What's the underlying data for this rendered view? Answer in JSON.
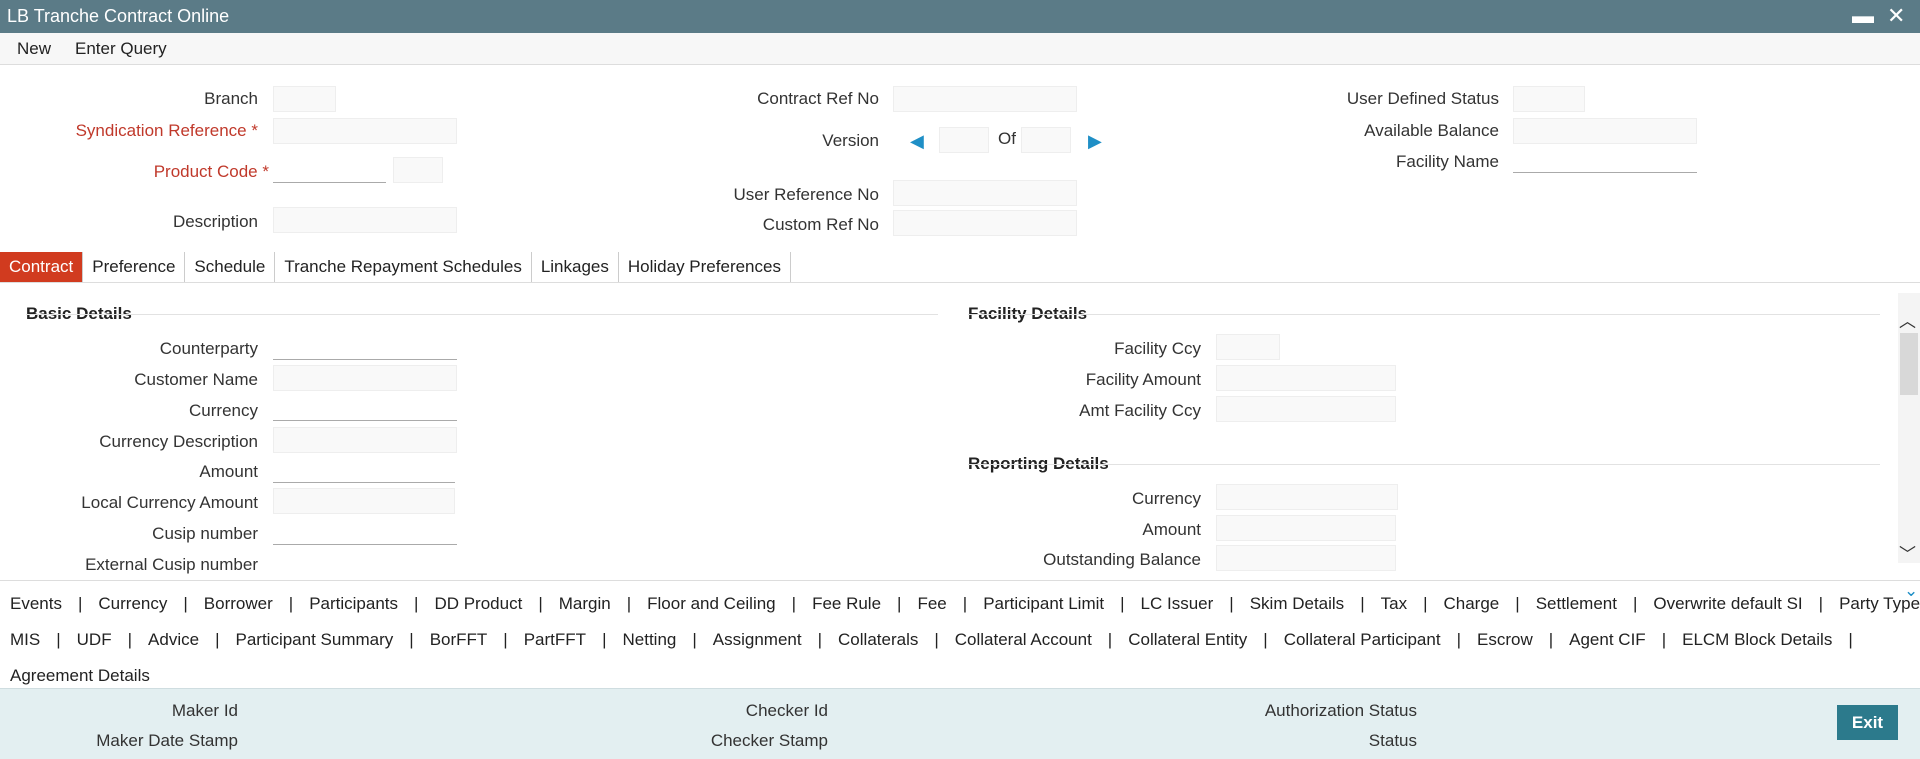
{
  "window": {
    "title": "LB Tranche Contract Online",
    "minimize_glyph": "▬",
    "close_glyph": "✕",
    "accent": "#5b7b87"
  },
  "menu": {
    "new_label": "New",
    "enter_query_label": "Enter Query"
  },
  "header": {
    "branch_label": "Branch",
    "syndication_label": "Syndication Reference",
    "product_code_label": "Product Code",
    "description_label": "Description",
    "contract_ref_label": "Contract Ref No",
    "version_label": "Version",
    "of_label": "Of",
    "user_ref_label": "User Reference No",
    "custom_ref_label": "Custom Ref No",
    "user_defined_status_label": "User Defined Status",
    "available_balance_label": "Available Balance",
    "facility_name_label": "Facility Name",
    "required_marker": "*"
  },
  "tabs": [
    "Contract",
    "Preference",
    "Schedule",
    "Tranche Repayment Schedules",
    "Linkages",
    "Holiday Preferences"
  ],
  "basic_details": {
    "title": "Basic Details",
    "counterparty": "Counterparty",
    "customer_name": "Customer Name",
    "currency": "Currency",
    "currency_description": "Currency Description",
    "amount": "Amount",
    "local_currency_amount": "Local Currency Amount",
    "cusip_number": "Cusip number",
    "external_cusip_number": "External Cusip number"
  },
  "facility_details": {
    "title": "Facility Details",
    "facility_ccy": "Facility Ccy",
    "facility_amount": "Facility Amount",
    "amt_facility_ccy": "Amt Facility Ccy"
  },
  "reporting_details": {
    "title": "Reporting Details",
    "currency": "Currency",
    "amount": "Amount",
    "outstanding_balance": "Outstanding Balance"
  },
  "sublinks": {
    "row1": [
      "Events",
      "Currency",
      "Borrower",
      "Participants",
      "DD Product",
      "Margin",
      "Floor and Ceiling",
      "Fee Rule",
      "Fee",
      "Participant Limit",
      "LC Issuer",
      "Skim Details",
      "Tax",
      "Charge",
      "Settlement",
      "Overwrite default SI",
      "Party Type"
    ],
    "row2": [
      "MIS",
      "UDF",
      "Advice",
      "Participant Summary",
      "BorFFT",
      "PartFFT",
      "Netting",
      "Assignment",
      "Collaterals",
      "Collateral Account",
      "Collateral Entity",
      "Collateral Participant",
      "Escrow",
      "Agent CIF",
      "ELCM Block Details"
    ],
    "row3": [
      "Agreement Details"
    ],
    "separator": "|"
  },
  "footer": {
    "maker_id": "Maker Id",
    "maker_date_stamp": "Maker Date Stamp",
    "checker_id": "Checker Id",
    "checker_stamp": "Checker Stamp",
    "authorization_status": "Authorization Status",
    "status": "Status",
    "exit_label": "Exit"
  },
  "glyphs": {
    "prev": "◀",
    "next": "▶",
    "scroll_up": "︿",
    "scroll_down": "﹀",
    "chevron_down": "⌄"
  }
}
